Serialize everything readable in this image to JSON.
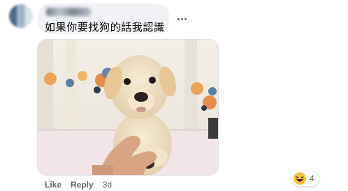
{
  "comment": {
    "text": "如果你要找狗的話我認識"
  },
  "actions": {
    "like": "Like",
    "reply": "Reply",
    "time": "3d"
  },
  "reactions": {
    "icon": "haha-emoji-icon",
    "count": "4"
  }
}
